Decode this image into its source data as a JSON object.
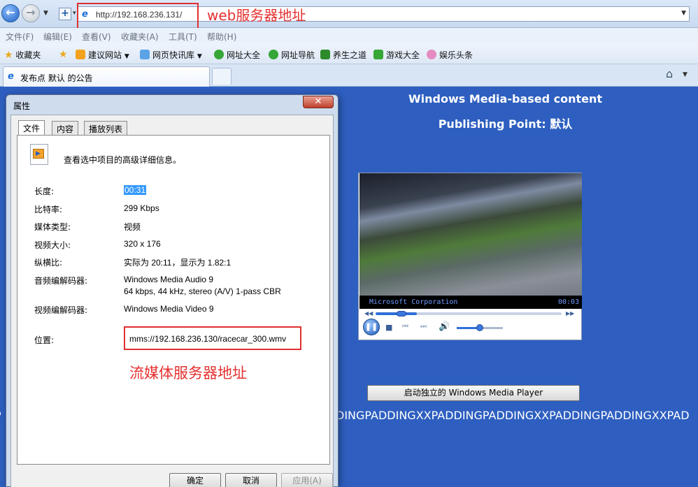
{
  "browser": {
    "url": "http://192.168.236.131/",
    "annotation_web": "web服务器地址",
    "menu": [
      "文件(F)",
      "编辑(E)",
      "查看(V)",
      "收藏夹(A)",
      "工具(T)",
      "帮助(H)"
    ],
    "favorites": [
      {
        "label": "收藏夹",
        "icon": "star-icon",
        "color": "#e8a91c"
      },
      {
        "label": "建议网站",
        "icon": "bing-icon",
        "color": "#f3a21e"
      },
      {
        "label": "网页快讯库",
        "icon": "ie-feed-icon",
        "color": "#5aa3e6"
      },
      {
        "label": "网址大全",
        "icon": "green-e-icon",
        "color": "#36a637"
      },
      {
        "label": "网址导航",
        "icon": "green-e-icon",
        "color": "#36a637"
      },
      {
        "label": "养生之道",
        "icon": "download-arrow-icon",
        "color": "#2d8b2d"
      },
      {
        "label": "游戏大全",
        "icon": "gamepad-icon",
        "color": "#36a637"
      },
      {
        "label": "娱乐头条",
        "icon": "candy-icon",
        "color": "#e58bc1"
      }
    ],
    "tab_title": "发布点 默认 的公告"
  },
  "page": {
    "title_line1": "Windows Media-based content",
    "title_line2": "Publishing Point: 默认",
    "player": {
      "copyright": "Microsoft Corporation",
      "time": "00:03",
      "seek_progress": 0.22,
      "volume": 0.5
    },
    "launch_button": "启动独立的 Windows Media Player",
    "padding_left": "P",
    "padding_right": "DINGPADDINGXXPADDINGPADDINGXXPADDINGPADDINGXXPAD"
  },
  "dialog": {
    "title": "属性",
    "tabs": [
      "文件",
      "内容",
      "播放列表"
    ],
    "description": "查看选中项目的高级详细信息。",
    "fields": [
      {
        "label": "长度:",
        "value": "00:31"
      },
      {
        "label": "比特率:",
        "value": "299 Kbps"
      },
      {
        "label": "媒体类型:",
        "value": "视频"
      },
      {
        "label": "视频大小:",
        "value": "320 x 176"
      },
      {
        "label": "纵横比:",
        "value": "实际为 20:11，显示为 1.82:1"
      },
      {
        "label": "音频编解码器:",
        "value": "Windows Media Audio 9",
        "value2": "64 kbps, 44 kHz, stereo (A/V) 1-pass CBR"
      },
      {
        "label": "视频编解码器:",
        "value": "Windows Media Video 9"
      },
      {
        "label": "位置:",
        "value": "mms://192.168.236.130/racecar_300.wmv"
      }
    ],
    "annotation_stream": "流媒体服务器地址",
    "buttons": {
      "ok": "确定",
      "cancel": "取消",
      "apply": "应用(A)"
    }
  }
}
